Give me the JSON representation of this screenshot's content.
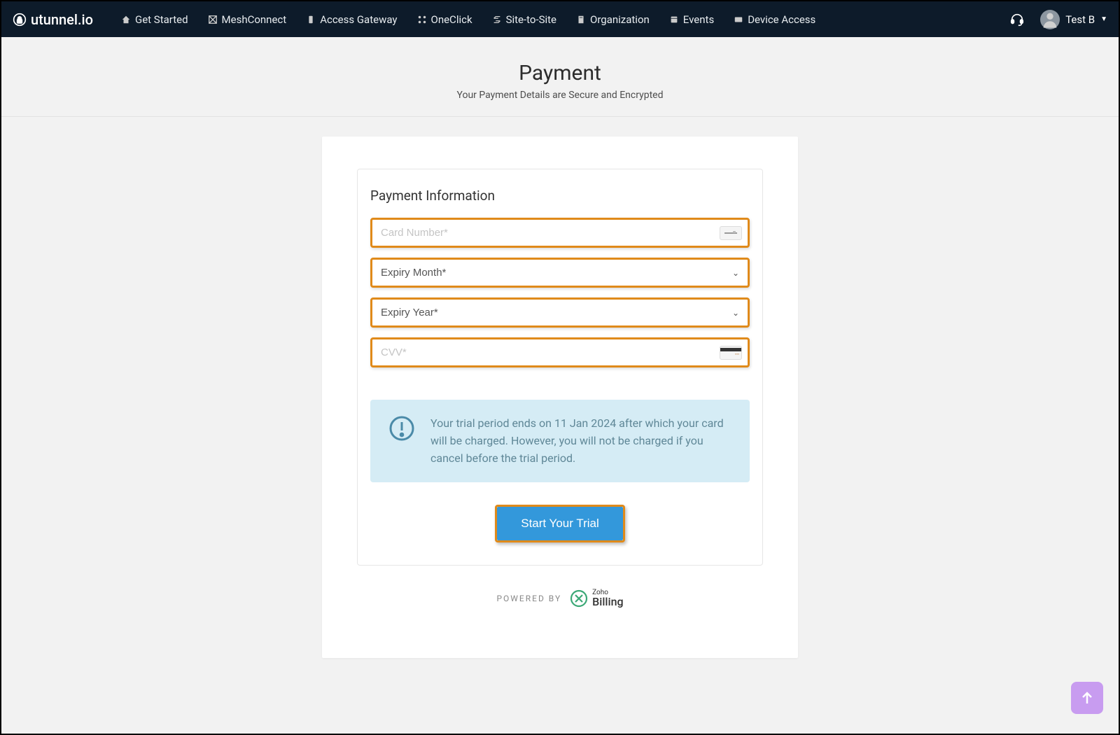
{
  "brand": {
    "name": "utunnel.io"
  },
  "nav": {
    "items": [
      {
        "label": "Get Started",
        "icon": "home"
      },
      {
        "label": "MeshConnect",
        "icon": "mesh"
      },
      {
        "label": "Access Gateway",
        "icon": "gateway"
      },
      {
        "label": "OneClick",
        "icon": "oneclick"
      },
      {
        "label": "Site-to-Site",
        "icon": "siteto"
      },
      {
        "label": "Organization",
        "icon": "org"
      },
      {
        "label": "Events",
        "icon": "events"
      },
      {
        "label": "Device Access",
        "icon": "device"
      }
    ],
    "user": "Test B"
  },
  "page": {
    "title": "Payment",
    "subtitle": "Your Payment Details are Secure and Encrypted"
  },
  "form": {
    "section_title": "Payment Information",
    "card_number_placeholder": "Card Number*",
    "expiry_month_label": "Expiry Month*",
    "expiry_year_label": "Expiry Year*",
    "cvv_placeholder": "CVV*",
    "info_message": "Your trial period ends on 11 Jan 2024 after which your card will be charged. However, you will not be charged if you cancel before the trial period.",
    "cta_label": "Start Your Trial"
  },
  "footer": {
    "powered_by": "POWERED BY",
    "provider_small": "Zoho",
    "provider_big": "Billing"
  },
  "colors": {
    "highlight": "#e08a1a",
    "primary": "#3398db",
    "navbg": "#0d1b2a",
    "info_bg": "#d5ecf5",
    "scroll_btn": "#c89cf0"
  }
}
